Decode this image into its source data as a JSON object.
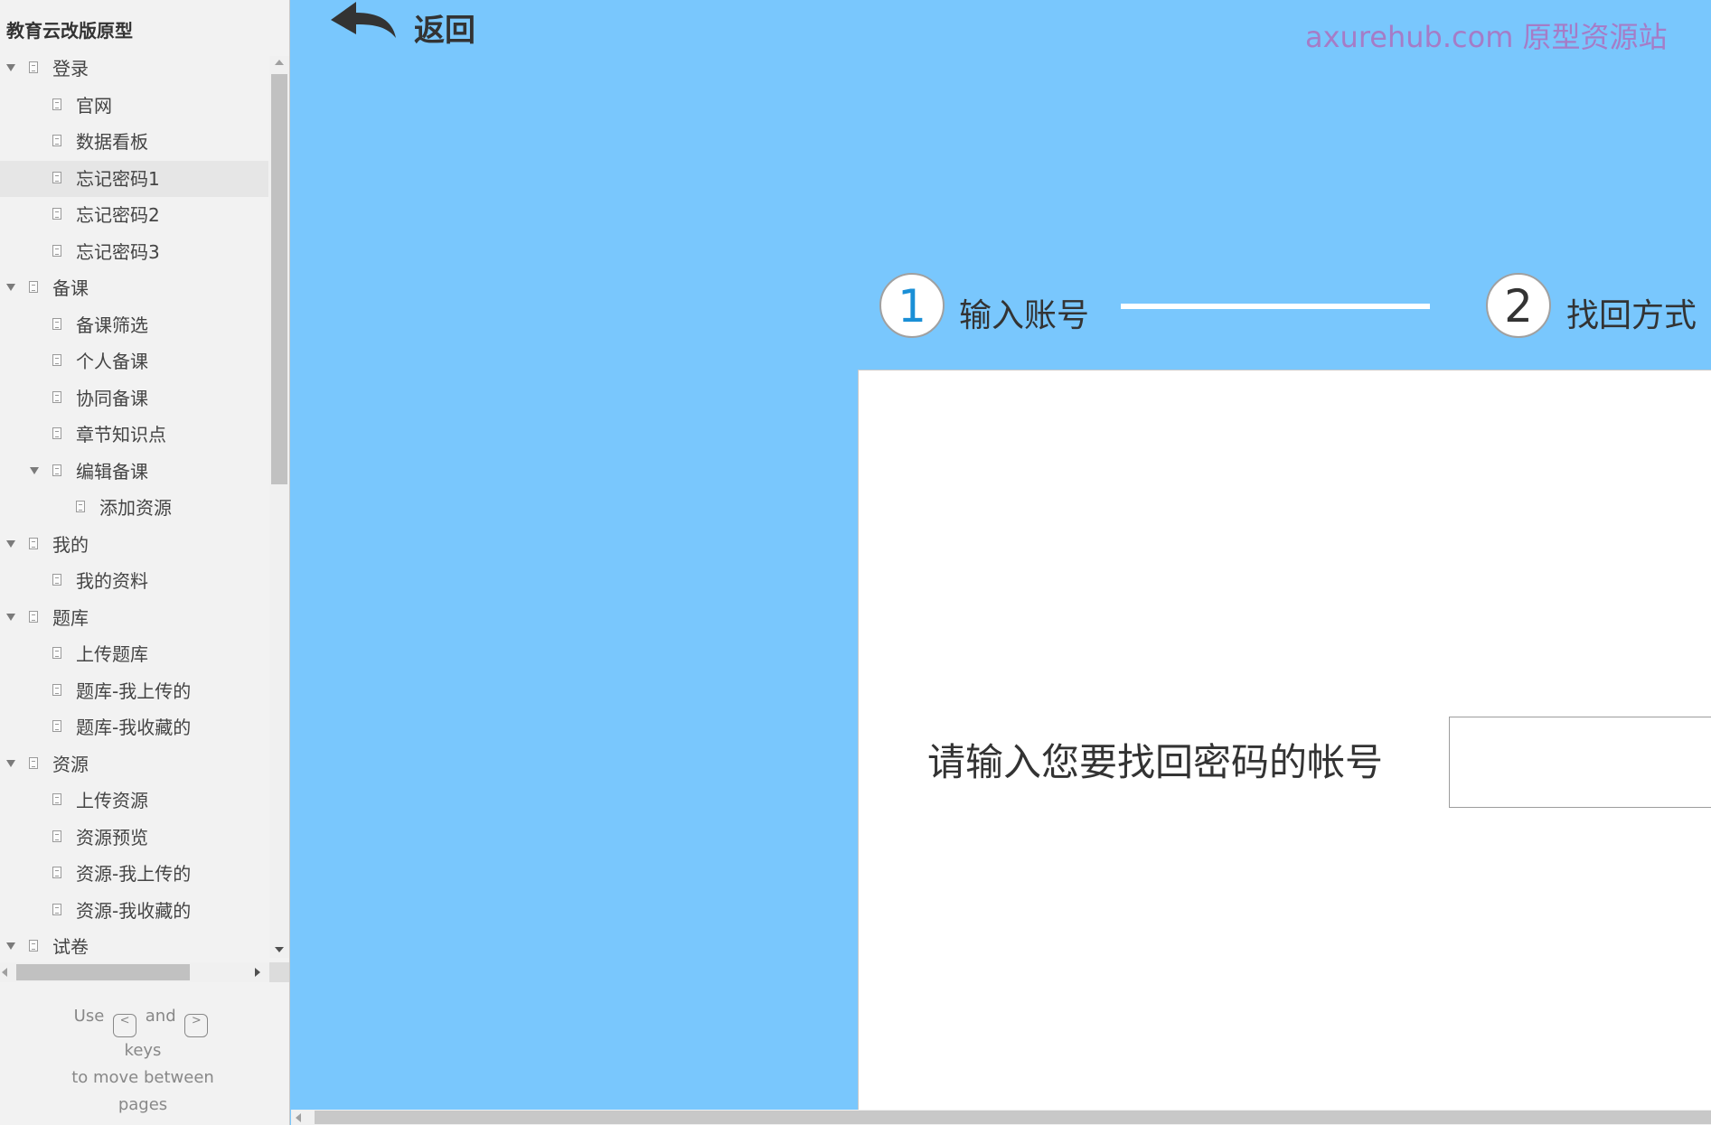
{
  "sidebar": {
    "title": "教育云改版原型",
    "items": [
      {
        "label": "登录",
        "level": 0,
        "expandable": true,
        "selected": false
      },
      {
        "label": "官网",
        "level": 1,
        "expandable": false,
        "selected": false
      },
      {
        "label": "数据看板",
        "level": 1,
        "expandable": false,
        "selected": false
      },
      {
        "label": "忘记密码1",
        "level": 1,
        "expandable": false,
        "selected": true
      },
      {
        "label": "忘记密码2",
        "level": 1,
        "expandable": false,
        "selected": false
      },
      {
        "label": "忘记密码3",
        "level": 1,
        "expandable": false,
        "selected": false
      },
      {
        "label": "备课",
        "level": 0,
        "expandable": true,
        "selected": false
      },
      {
        "label": "备课筛选",
        "level": 1,
        "expandable": false,
        "selected": false
      },
      {
        "label": "个人备课",
        "level": 1,
        "expandable": false,
        "selected": false
      },
      {
        "label": "协同备课",
        "level": 1,
        "expandable": false,
        "selected": false
      },
      {
        "label": "章节知识点",
        "level": 1,
        "expandable": false,
        "selected": false
      },
      {
        "label": "编辑备课",
        "level": 1,
        "expandable": true,
        "selected": false
      },
      {
        "label": "添加资源",
        "level": 2,
        "expandable": false,
        "selected": false
      },
      {
        "label": "我的",
        "level": 0,
        "expandable": true,
        "selected": false
      },
      {
        "label": "我的资料",
        "level": 1,
        "expandable": false,
        "selected": false
      },
      {
        "label": "题库",
        "level": 0,
        "expandable": true,
        "selected": false
      },
      {
        "label": "上传题库",
        "level": 1,
        "expandable": false,
        "selected": false
      },
      {
        "label": "题库-我上传的",
        "level": 1,
        "expandable": false,
        "selected": false
      },
      {
        "label": "题库-我收藏的",
        "level": 1,
        "expandable": false,
        "selected": false
      },
      {
        "label": "资源",
        "level": 0,
        "expandable": true,
        "selected": false
      },
      {
        "label": "上传资源",
        "level": 1,
        "expandable": false,
        "selected": false
      },
      {
        "label": "资源预览",
        "level": 1,
        "expandable": false,
        "selected": false
      },
      {
        "label": "资源-我上传的",
        "level": 1,
        "expandable": false,
        "selected": false
      },
      {
        "label": "资源-我收藏的",
        "level": 1,
        "expandable": false,
        "selected": false
      },
      {
        "label": "试卷",
        "level": 0,
        "expandable": true,
        "selected": false
      }
    ],
    "hint": {
      "use": "Use",
      "key_prev": "<",
      "and": "and",
      "key_next": ">",
      "keys": "keys",
      "line2": "to move between",
      "line3": "pages"
    }
  },
  "main": {
    "back_label": "返回",
    "watermark": "axurehub.com 原型资源站",
    "steps": [
      {
        "number": "1",
        "label": "输入账号",
        "color": "#1a8fd6"
      },
      {
        "number": "2",
        "label": "找回方式",
        "color": "#333333"
      }
    ],
    "form": {
      "prompt": "请输入您要找回密码的帐号",
      "account_value": ""
    }
  },
  "colors": {
    "background": "#79c7fd",
    "panel": "#ffffff",
    "watermark": "#a57cc7",
    "sidebar": "#f2f2f2"
  }
}
